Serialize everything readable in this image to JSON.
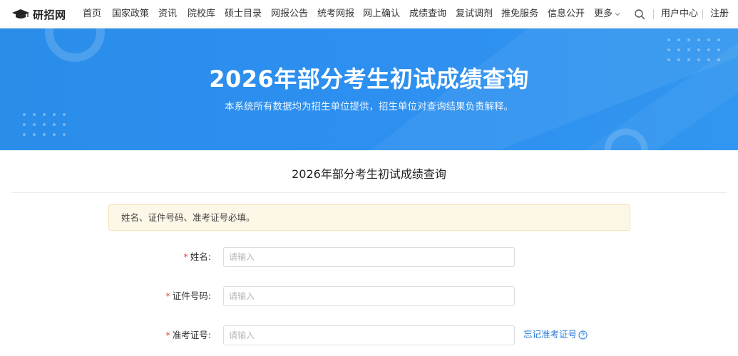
{
  "brand": {
    "name": "研招网"
  },
  "nav": {
    "items": [
      "首页",
      "国家政策",
      "资讯",
      "院校库",
      "硕士目录",
      "网报公告",
      "统考网报",
      "网上确认",
      "成绩查询",
      "复试调剂",
      "推免服务",
      "信息公开"
    ],
    "more_label": "更多",
    "user_center": "用户中心",
    "register": "注册"
  },
  "hero": {
    "title": "2026年部分考生初试成绩查询",
    "subtitle": "本系统所有数据均为招生单位提供，招生单位对查询结果负责解释。"
  },
  "form": {
    "title": "2026年部分考生初试成绩查询",
    "notice": "姓名、证件号码、准考证号必填。",
    "required_mark": "*",
    "fields": [
      {
        "label": "姓名:",
        "placeholder": "请输入",
        "value": ""
      },
      {
        "label": "证件号码:",
        "placeholder": "请输入",
        "value": ""
      },
      {
        "label": "准考证号:",
        "placeholder": "请输入",
        "value": ""
      }
    ],
    "forgot_link": "忘记准考证号"
  },
  "icons": {
    "logo": "graduation-cap-icon",
    "search": "search-icon",
    "more": "chevron-down-icon",
    "help": "question-circle-icon"
  },
  "colors": {
    "hero_blue": "#2d8ff0",
    "link_blue": "#2d7fd9",
    "required_red": "#e53935",
    "notice_bg": "#fdf7e7"
  }
}
